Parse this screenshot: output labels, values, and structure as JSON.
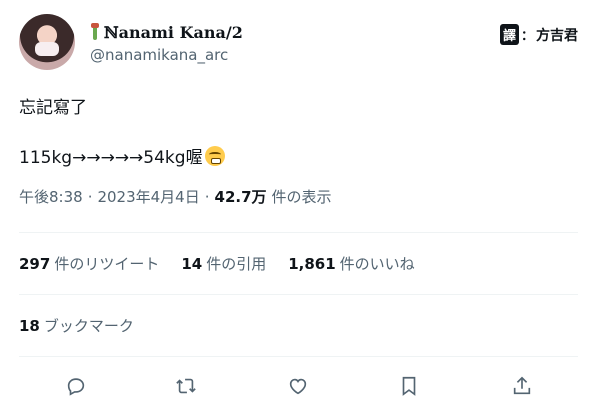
{
  "author": {
    "display_name": "ℕanami Kana/2",
    "handle": "@nanamikana_arc"
  },
  "watermark": {
    "badge": "譯",
    "separator": "：",
    "name": "方吉君"
  },
  "tweet": {
    "line1": "忘記寫了",
    "line2": "115kg→→→→→54kg喔",
    "emoji_name": "grimacing-face-icon"
  },
  "meta": {
    "time": "午後8:38",
    "sep1": "·",
    "date": "2023年4月4日",
    "sep2": "·",
    "views_count": "42.7万",
    "views_label": "件の表示"
  },
  "stats": {
    "retweets_count": "297",
    "retweets_label": "件のリツイート",
    "quotes_count": "14",
    "quotes_label": "件の引用",
    "likes_count": "1,861",
    "likes_label": "件のいいね"
  },
  "bookmarks": {
    "count": "18",
    "label": "ブックマーク"
  },
  "actions": [
    "reply-icon",
    "retweet-icon",
    "like-icon",
    "bookmark-icon",
    "share-icon"
  ],
  "colors": {
    "text": "#0f1419",
    "muted": "#536471",
    "divider": "#eff3f4"
  }
}
